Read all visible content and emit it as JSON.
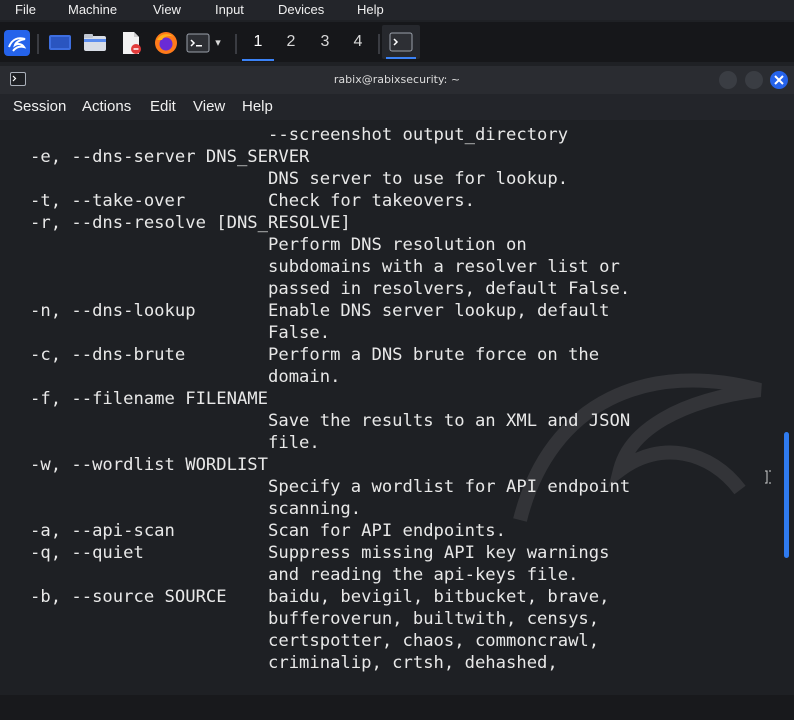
{
  "vbox_menu": [
    "File",
    "Machine",
    "View",
    "Input",
    "Devices",
    "Help"
  ],
  "taskbar": {
    "icons": [
      "kali-dragon-icon",
      "desktop-icon",
      "file-manager-icon",
      "text-editor-icon",
      "firefox-icon",
      "terminal-icon"
    ],
    "workspaces": [
      "1",
      "2",
      "3",
      "4"
    ],
    "active_workspace": "1"
  },
  "terminal": {
    "title": "rabix@rabixsecurity: ~",
    "menu": [
      "Session",
      "Actions",
      "Edit",
      "View",
      "Help"
    ],
    "lines": [
      "                       --screenshot output_directory",
      "-e, --dns-server DNS_SERVER",
      "                       DNS server to use for lookup.",
      "-t, --take-over        Check for takeovers.",
      "-r, --dns-resolve [DNS_RESOLVE]",
      "                       Perform DNS resolution on",
      "                       subdomains with a resolver list or",
      "                       passed in resolvers, default False.",
      "-n, --dns-lookup       Enable DNS server lookup, default",
      "                       False.",
      "-c, --dns-brute        Perform a DNS brute force on the",
      "                       domain.",
      "-f, --filename FILENAME",
      "                       Save the results to an XML and JSON",
      "                       file.",
      "-w, --wordlist WORDLIST",
      "                       Specify a wordlist for API endpoint",
      "                       scanning.",
      "-a, --api-scan         Scan for API endpoints.",
      "-q, --quiet            Suppress missing API key warnings",
      "                       and reading the api-keys file.",
      "-b, --source SOURCE    baidu, bevigil, bitbucket, brave,",
      "                       bufferoverun, builtwith, censys,",
      "                       certspotter, chaos, commoncrawl,",
      "                       criminalip, crtsh, dehashed,"
    ]
  },
  "colors": {
    "accent": "#3b82f6",
    "terminal_bg": "#1e2024",
    "close_button": "#2563eb"
  }
}
